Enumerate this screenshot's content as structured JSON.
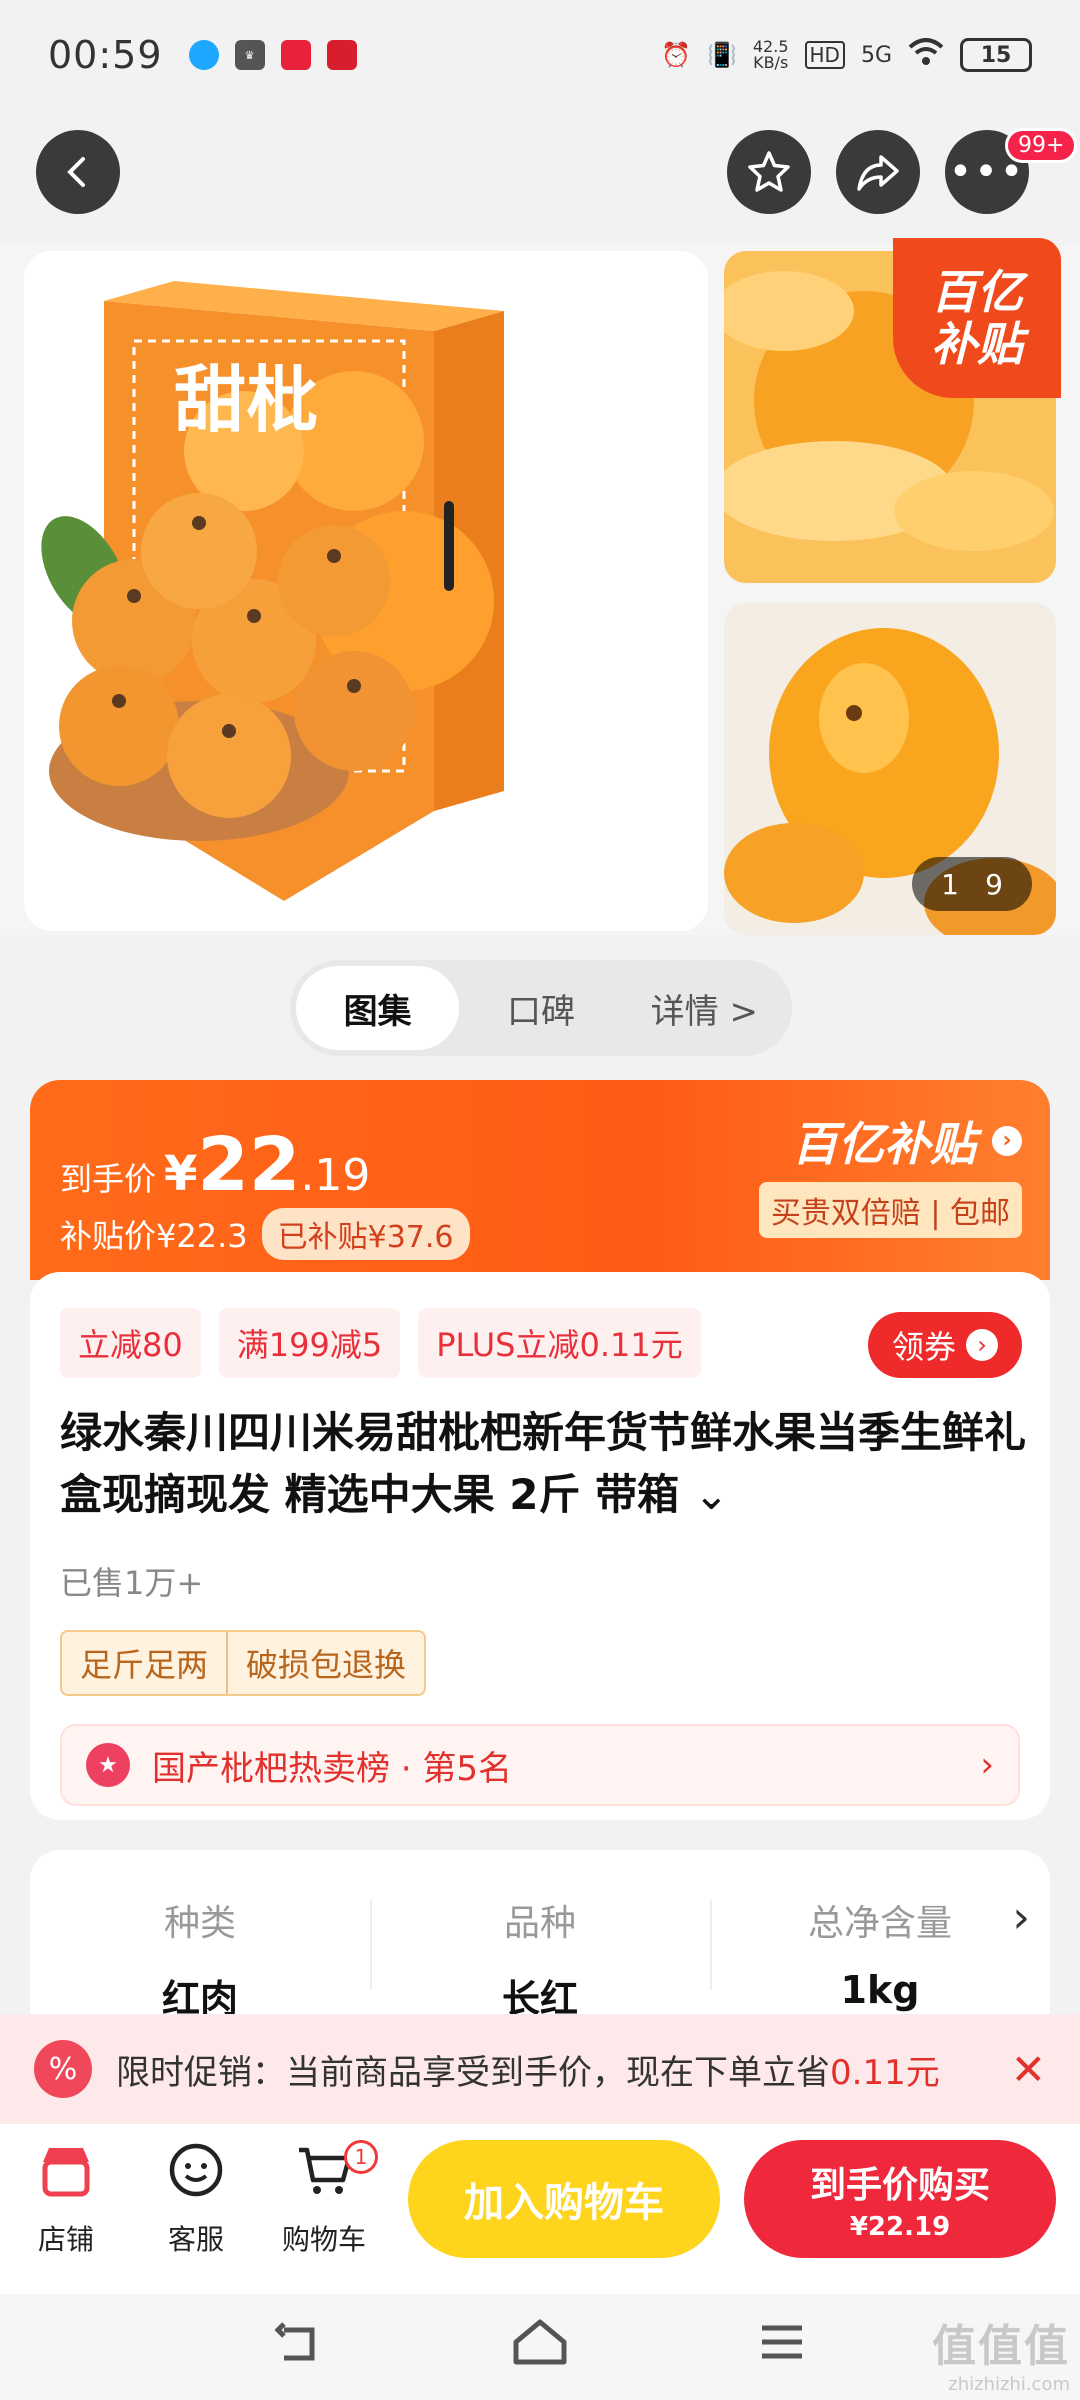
{
  "status_bar": {
    "time": "00:59",
    "network_speed": "42.5",
    "network_unit": "KB/s",
    "hd": "HD",
    "signal": "5G",
    "battery": "15"
  },
  "top_nav": {
    "more_badge": "99+"
  },
  "gallery": {
    "box_text": "甜枇",
    "corner_badge_line1": "百亿",
    "corner_badge_line2": "补贴",
    "counter_current": "1",
    "counter_total": "9"
  },
  "tabs": [
    {
      "label": "图集",
      "active": true
    },
    {
      "label": "口碑",
      "active": false
    },
    {
      "label": "详情 >",
      "active": false
    }
  ],
  "price": {
    "label": "到手价",
    "currency": "¥",
    "integer": "22",
    "decimal": ".19",
    "subsidy_price": "补贴价¥22.3",
    "subsidized": "已补贴¥37.6",
    "brand_logo": "百亿补贴",
    "brand_tags": "买贵双倍赔 | 包邮"
  },
  "product": {
    "coupons": [
      "立减80",
      "满199减5",
      "PLUS立减0.11元"
    ],
    "get_coupon": "领券",
    "title": "绿水秦川四川米易甜枇杷新年货节鲜水果当季生鲜礼盒现摘现发 精选中大果 2斤 带箱",
    "sold": "已售1万+",
    "guarantees": [
      "足斤足两",
      "破损包退换"
    ],
    "rank": "国产枇杷热卖榜 · 第5名"
  },
  "specs": [
    {
      "key": "种类",
      "value": "红肉"
    },
    {
      "key": "品种",
      "value": "长红"
    },
    {
      "key": "总净含量",
      "value": "1kg"
    }
  ],
  "promo": {
    "text": "限时促销：当前商品享受到手价，现在下单立省",
    "highlight": "0.11元"
  },
  "bottom_bar": {
    "store": "店铺",
    "service": "客服",
    "cart": "购物车",
    "cart_count": "1",
    "add_to_cart": "加入购物车",
    "buy_label": "到手价购买",
    "buy_price": "¥22.19"
  },
  "watermark": {
    "line1": "值值值",
    "line2": "zhizhizhi.com"
  },
  "colors": {
    "accent_orange": "#ff5a16",
    "accent_red": "#f0283c",
    "cart_yellow": "#ffd41c"
  }
}
